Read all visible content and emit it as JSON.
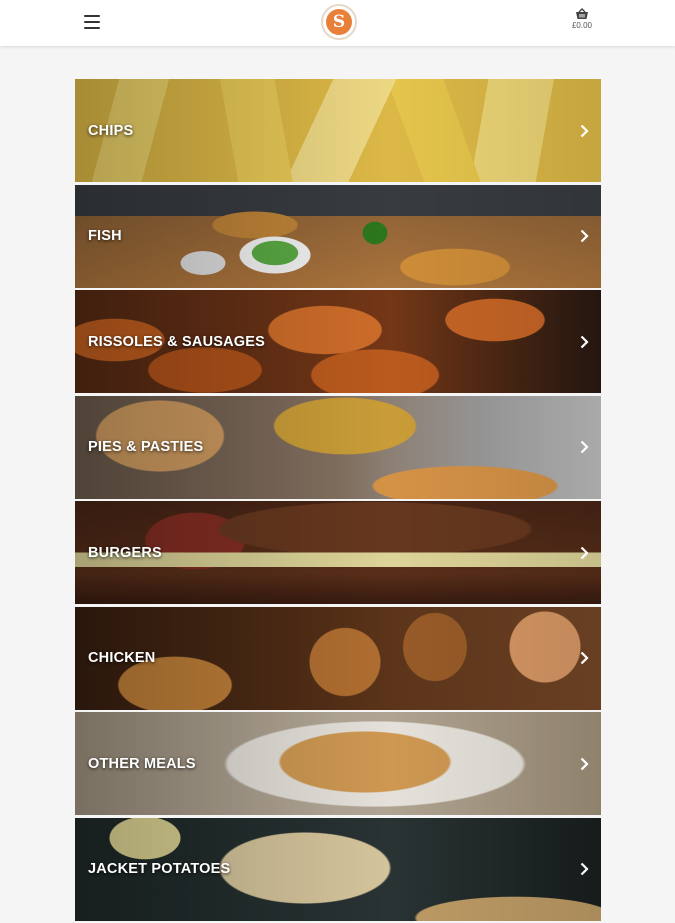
{
  "header": {
    "menu_icon": "hamburger-menu-icon",
    "logo_letter": "S",
    "basket_icon": "basket-icon",
    "basket_total": "£0.00"
  },
  "categories": [
    {
      "label": "CHIPS",
      "image": "chips"
    },
    {
      "label": "FISH",
      "image": "fish"
    },
    {
      "label": "RISSOLES & SAUSAGES",
      "image": "sausages"
    },
    {
      "label": "PIES & PASTIES",
      "image": "pies"
    },
    {
      "label": "BURGERS",
      "image": "burgers"
    },
    {
      "label": "CHICKEN",
      "image": "chicken"
    },
    {
      "label": "OTHER MEALS",
      "image": "other"
    },
    {
      "label": "JACKET POTATOES",
      "image": "jacket"
    }
  ],
  "chevron_icon": "chevron-right-icon"
}
